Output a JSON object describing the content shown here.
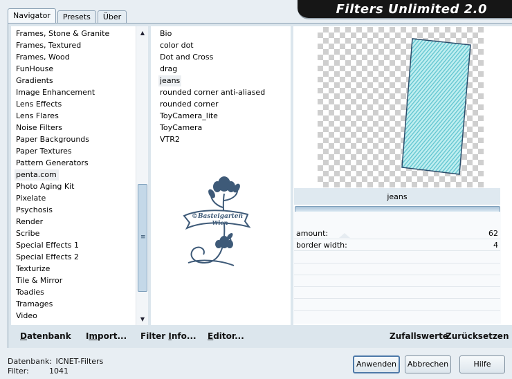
{
  "window": {
    "title": "Filters Unlimited 2.0",
    "tabs": [
      "Navigator",
      "Presets",
      "Über"
    ]
  },
  "categories": {
    "items": [
      "Frames, Stone & Granite",
      "Frames, Textured",
      "Frames, Wood",
      "FunHouse",
      "Gradients",
      "Image Enhancement",
      "Lens Effects",
      "Lens Flares",
      "Noise Filters",
      "Paper Backgrounds",
      "Paper Textures",
      "Pattern Generators",
      "penta.com",
      "Photo Aging Kit",
      "Pixelate",
      "Psychosis",
      "Render",
      "Scribe",
      "Special Effects 1",
      "Special Effects 2",
      "Texturize",
      "Tile & Mirror",
      "Toadies",
      "Tramages",
      "Video"
    ],
    "selected": "penta.com",
    "scroll_grip": "≡"
  },
  "filters": {
    "items": [
      "Bio",
      "color dot",
      "Dot and Cross",
      "drag",
      "jeans",
      "rounded corner anti-aliased",
      "rounded corner",
      "ToyCamera_lite",
      "ToyCamera",
      "VTR2"
    ],
    "selected": "jeans"
  },
  "watermark": {
    "line1": "©Basteigarten",
    "line2": "Wien"
  },
  "preview": {
    "filter_name": "jeans"
  },
  "parameters": [
    {
      "label": "amount:",
      "value": "62"
    },
    {
      "label": "border width:",
      "value": "4"
    }
  ],
  "bottom_buttons": {
    "datenbank": {
      "u": "D",
      "rest": "atenbank"
    },
    "import": {
      "pre": "I",
      "u": "m",
      "rest": "port..."
    },
    "filter_info": {
      "pre": "Filter ",
      "u": "I",
      "rest": "nfo..."
    },
    "editor": {
      "u": "E",
      "rest": "ditor..."
    },
    "zufallswerte": "Zufallswerte",
    "zuruecksetzen": "Zurücksetzen"
  },
  "status": {
    "datenbank_label": "Datenbank:",
    "datenbank_value": "ICNET-Filters",
    "filter_label": "Filter:",
    "filter_value": "1041"
  },
  "buttons": {
    "apply": "Anwenden",
    "cancel": "Abbrechen",
    "help": "Hilfe"
  },
  "colors": {
    "accent": "#4d79a8",
    "preview_fill": "#bfeef0",
    "preview_stripe": "#5fc4cf",
    "logo": "#3e5a78"
  }
}
